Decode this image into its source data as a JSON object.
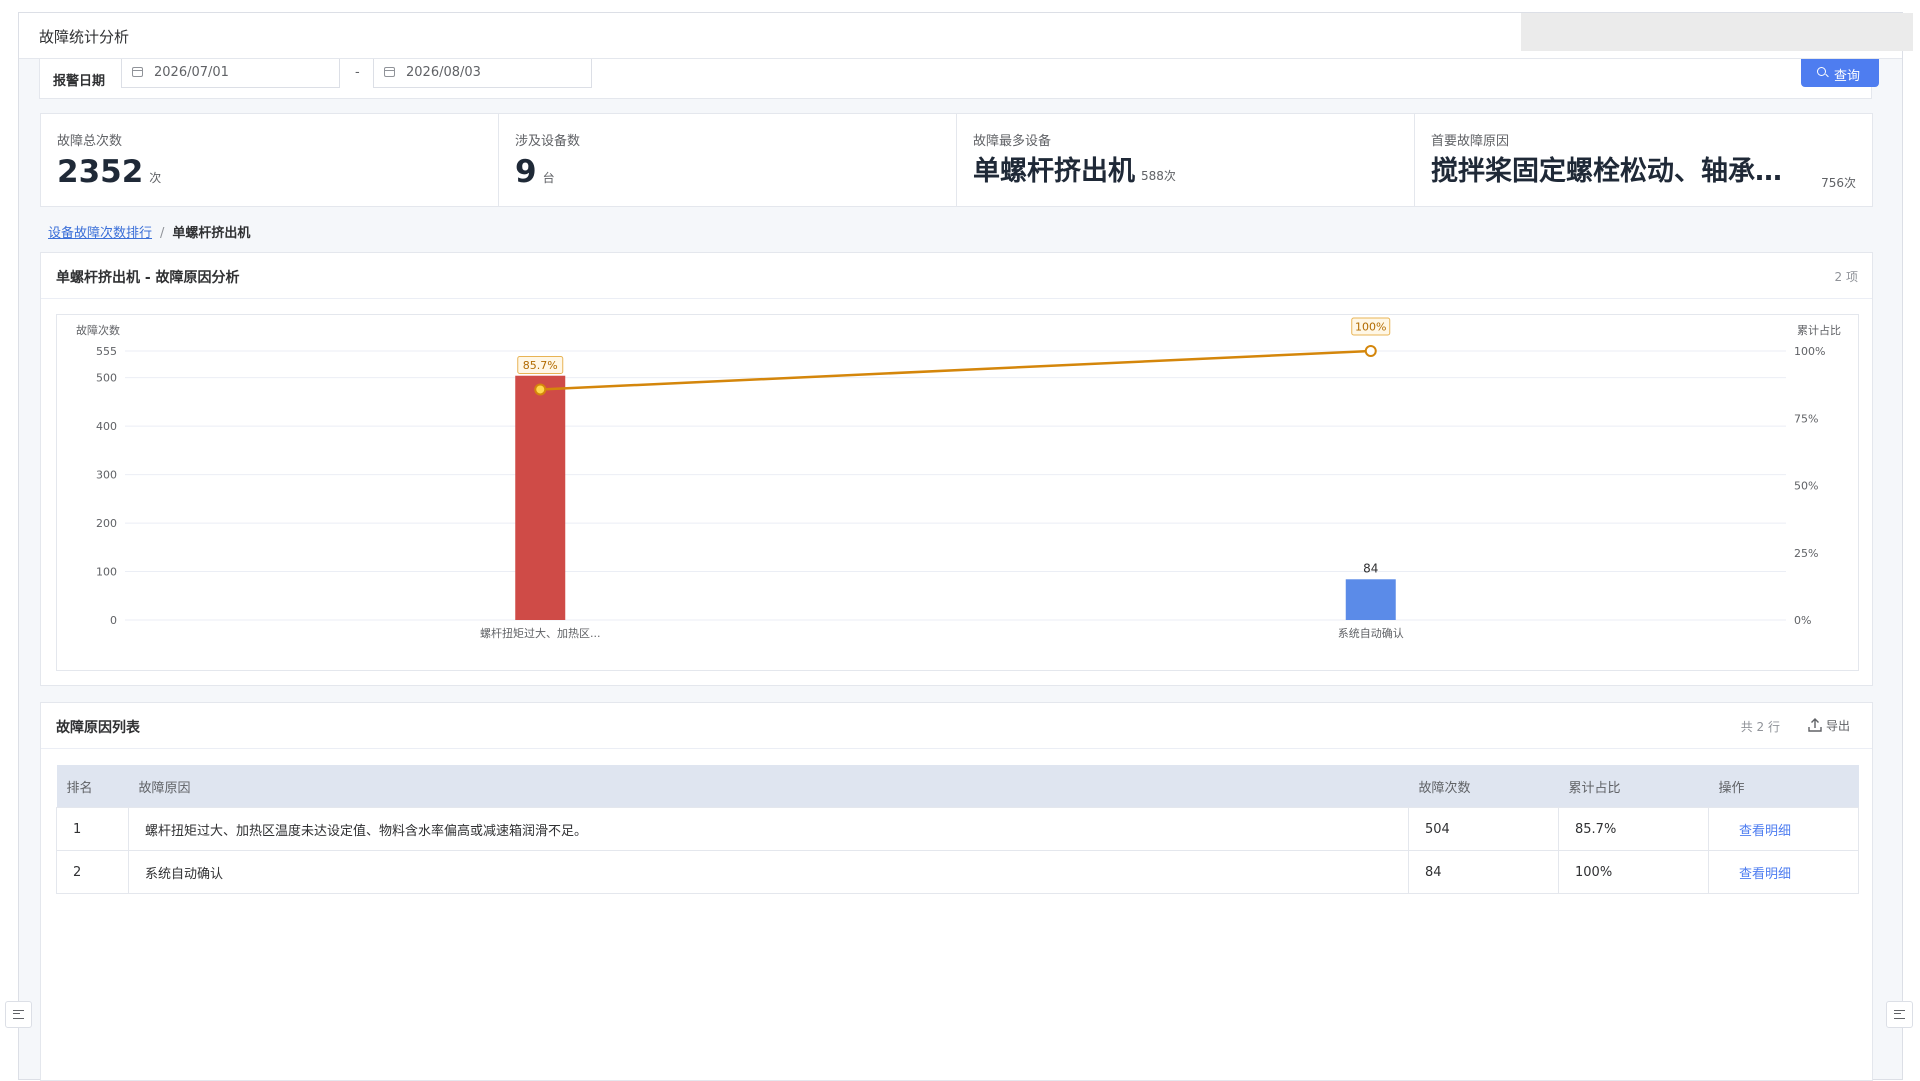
{
  "window": {
    "title": "故障统计分析"
  },
  "filter": {
    "label": "报警日期",
    "start_date": "2026/07/01",
    "separator": "-",
    "end_date": "2026/08/03",
    "query_label": "查询"
  },
  "kpis": [
    {
      "label": "故障总次数",
      "value": "2352",
      "unit": "次"
    },
    {
      "label": "涉及设备数",
      "value": "9",
      "unit": "台"
    },
    {
      "label": "故障最多设备",
      "value": "单螺杆挤出机",
      "unit": "588次"
    },
    {
      "label": "首要故障原因",
      "value": "搅拌桨固定螺栓松动、轴承磨损",
      "unit": "756次"
    }
  ],
  "breadcrumb": {
    "parent": "设备故障次数排行",
    "separator": "/",
    "current": "单螺杆挤出机"
  },
  "analysis_panel": {
    "title": "单螺杆挤出机 - 故障原因分析",
    "count_text": "2 项"
  },
  "chart_data": {
    "type": "bar",
    "categories": [
      "螺杆扭矩过大、加热区...",
      "系统自动确认"
    ],
    "series": [
      {
        "values": [
          504,
          84
        ],
        "colors": [
          "#cf4b47",
          "#5b8be8"
        ]
      },
      {
        "type": "line",
        "values": [
          85.7,
          100
        ],
        "labels": [
          "85.7%",
          "100%"
        ],
        "color": "#d4860b"
      }
    ],
    "ylabel": "故障次数",
    "ylabel_right": "累计占比",
    "ylim": [
      0,
      555
    ],
    "yticks": [
      "0",
      "100",
      "200",
      "300",
      "400",
      "500",
      "555"
    ],
    "y2lim": [
      0,
      100
    ],
    "y2ticks": [
      "0%",
      "25%",
      "50%",
      "75%",
      "100%"
    ],
    "bar_labels": [
      "",
      "84"
    ],
    "grid": true
  },
  "list_panel": {
    "title": "故障原因列表",
    "rows_count": "共 2 行",
    "export_label": "导出",
    "columns": [
      "排名",
      "故障原因",
      "故障次数",
      "累计占比",
      "操作"
    ],
    "rows": [
      {
        "rank": "1",
        "reason": "螺杆扭矩过大、加热区温度未达设定值、物料含水率偏高或减速箱润滑不足。",
        "count": "504",
        "cumulative": "85.7%",
        "action": "查看明细"
      },
      {
        "rank": "2",
        "reason": "系统自动确认",
        "count": "84",
        "cumulative": "100%",
        "action": "查看明细"
      }
    ]
  }
}
